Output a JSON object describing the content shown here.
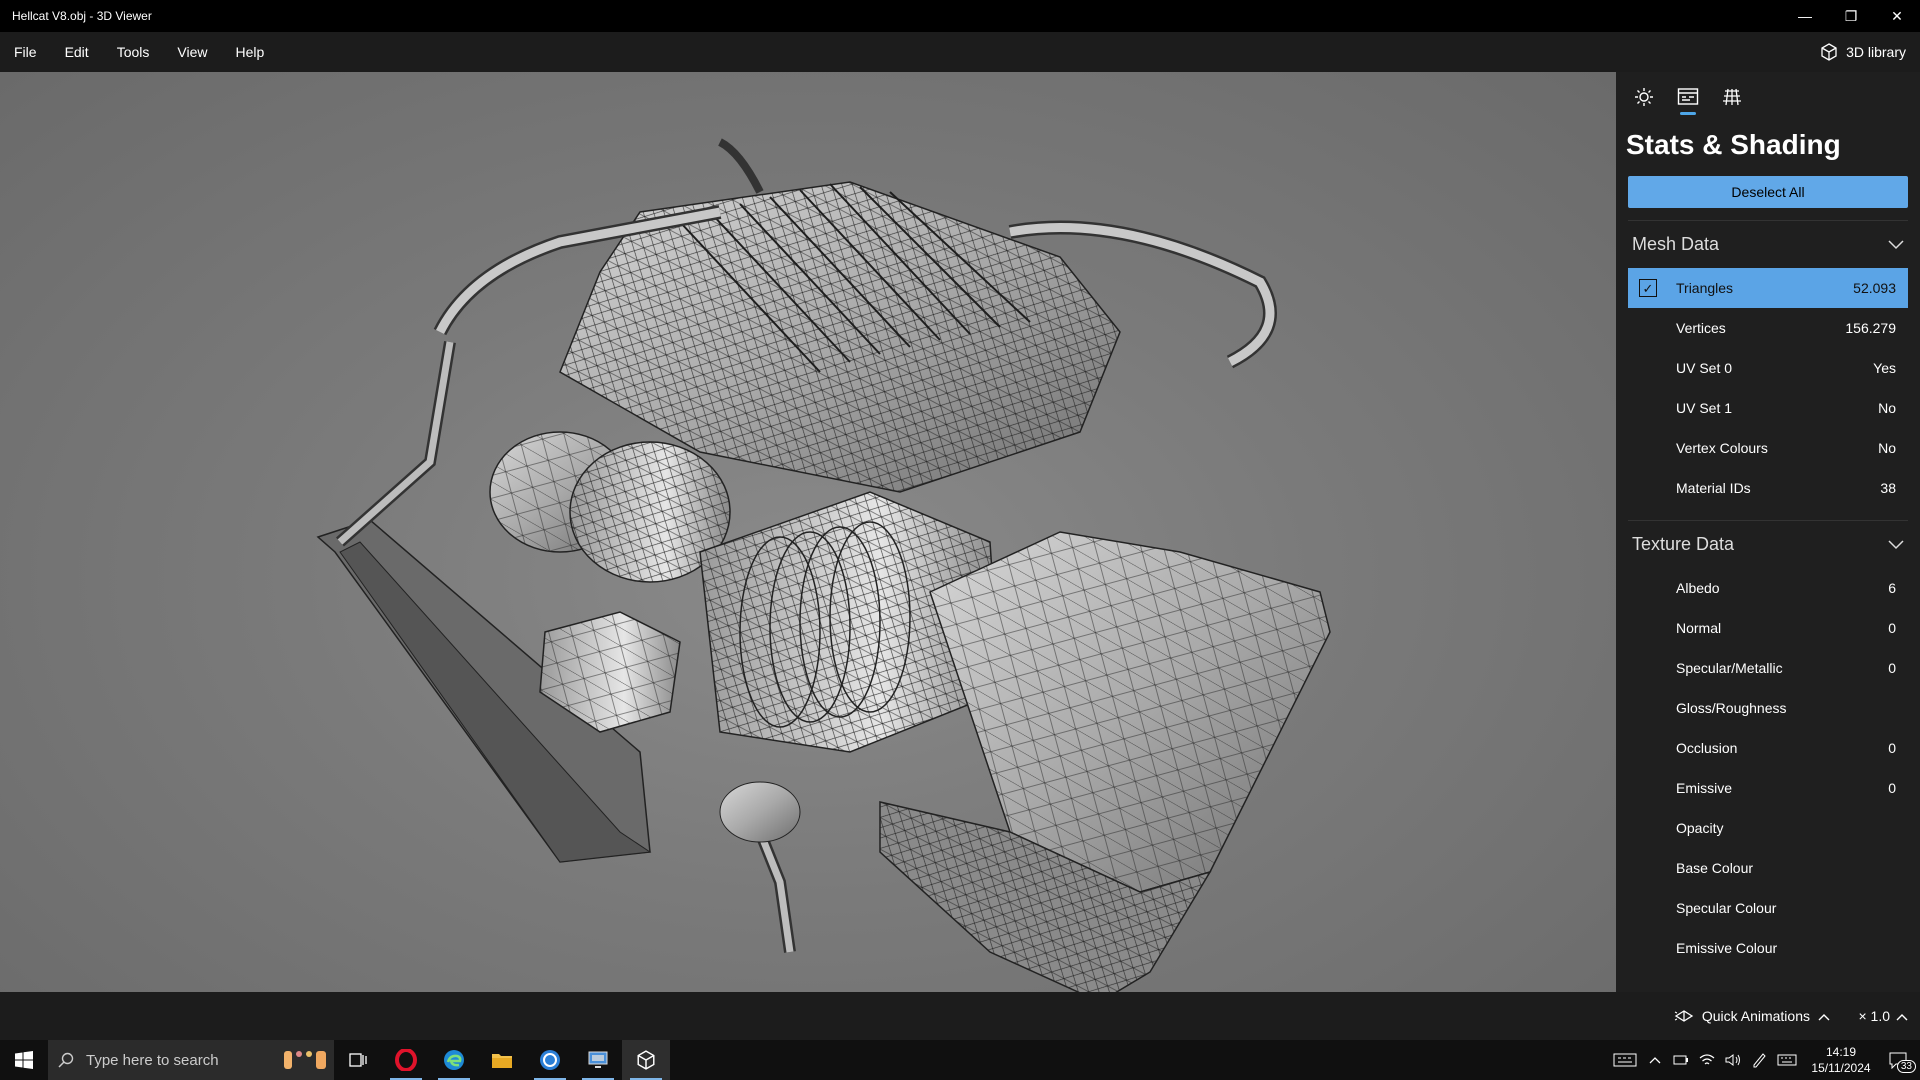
{
  "window": {
    "title": "Hellcat V8.obj - 3D Viewer"
  },
  "menu": {
    "items": [
      "File",
      "Edit",
      "Tools",
      "View",
      "Help"
    ],
    "library_label": "3D library"
  },
  "panel": {
    "title": "Stats & Shading",
    "deselect_label": "Deselect All",
    "mesh": {
      "header": "Mesh Data",
      "rows": [
        {
          "label": "Triangles",
          "value": "52.093",
          "checked": true
        },
        {
          "label": "Vertices",
          "value": "156.279"
        },
        {
          "label": "UV Set 0",
          "value": "Yes"
        },
        {
          "label": "UV Set 1",
          "value": "No"
        },
        {
          "label": "Vertex Colours",
          "value": "No"
        },
        {
          "label": "Material IDs",
          "value": "38"
        }
      ]
    },
    "texture": {
      "header": "Texture Data",
      "rows": [
        {
          "label": "Albedo",
          "value": "6"
        },
        {
          "label": "Normal",
          "value": "0"
        },
        {
          "label": "Specular/Metallic",
          "value": "0"
        },
        {
          "label": "Gloss/Roughness",
          "value": ""
        },
        {
          "label": "Occlusion",
          "value": "0"
        },
        {
          "label": "Emissive",
          "value": "0"
        },
        {
          "label": "Opacity",
          "value": ""
        },
        {
          "label": "Base Colour",
          "value": ""
        },
        {
          "label": "Specular Colour",
          "value": ""
        },
        {
          "label": "Emissive Colour",
          "value": ""
        }
      ]
    }
  },
  "bottom": {
    "quick_animations": "Quick Animations",
    "speed": "× 1.0"
  },
  "taskbar": {
    "search_placeholder": "Type here to search",
    "time": "14:19",
    "date": "15/11/2024",
    "notification_count": "33"
  },
  "colors": {
    "accent": "#5ba4e6",
    "panel_bg": "#1f1f1f",
    "viewport_bg": "#7a7a7a"
  }
}
